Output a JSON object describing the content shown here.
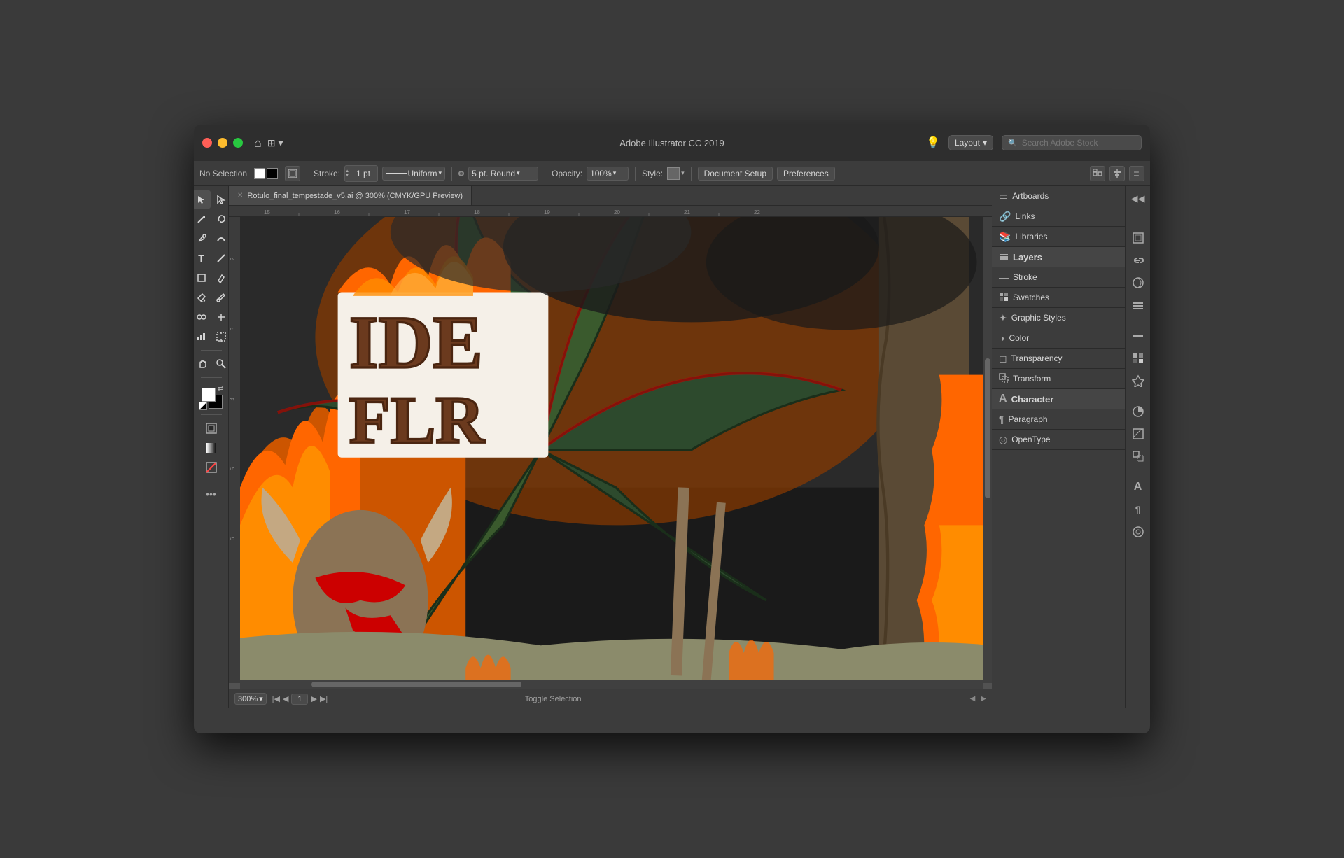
{
  "app": {
    "title": "Adobe Illustrator CC 2019",
    "window_title": "Adobe Illustrator CC 2019"
  },
  "titlebar": {
    "title": "Adobe Illustrator CC 2019",
    "layout_label": "Layout",
    "search_placeholder": "Search Adobe Stock",
    "home_icon": "⌂",
    "workspace_icon": "⊞",
    "lightbulb_icon": "💡"
  },
  "toolbar": {
    "no_selection": "No Selection",
    "stroke_label": "Stroke:",
    "stroke_value": "1 pt",
    "stroke_type": "Uniform",
    "pt_round": "5 pt. Round",
    "opacity_label": "Opacity:",
    "opacity_value": "100%",
    "style_label": "Style:",
    "document_setup": "Document Setup",
    "preferences": "Preferences"
  },
  "tab": {
    "filename": "Rotulo_final_tempestade_v5.ai @ 300% (CMYK/GPU Preview)"
  },
  "canvas": {
    "zoom": "300%",
    "page": "1",
    "toggle_selection": "Toggle Selection"
  },
  "right_panels": {
    "sections": [
      {
        "id": "artboards",
        "label": "Artboards",
        "icon": "▭"
      },
      {
        "id": "links",
        "label": "Links",
        "icon": "🔗"
      },
      {
        "id": "libraries",
        "label": "Libraries",
        "icon": "📚"
      },
      {
        "id": "layers",
        "label": "Layers",
        "icon": "▤"
      },
      {
        "id": "stroke",
        "label": "Stroke",
        "icon": "—"
      },
      {
        "id": "swatches",
        "label": "Swatches",
        "icon": "◼"
      },
      {
        "id": "graphic_styles",
        "label": "Graphic Styles",
        "icon": "✦"
      },
      {
        "id": "color",
        "label": "Color",
        "icon": "◑"
      },
      {
        "id": "transparency",
        "label": "Transparency",
        "icon": "◻"
      },
      {
        "id": "transform",
        "label": "Transform",
        "icon": "⊞"
      },
      {
        "id": "character",
        "label": "Character",
        "icon": "A"
      },
      {
        "id": "paragraph",
        "label": "Paragraph",
        "icon": "¶"
      },
      {
        "id": "opentype",
        "label": "OpenType",
        "icon": "◎"
      }
    ]
  },
  "tools": {
    "select": "▶",
    "direct_select": "↖",
    "pen": "✒",
    "curvature": "~",
    "type": "T",
    "line": "/",
    "rect": "□",
    "pencil": "✏",
    "paintbucket": "◈",
    "eyedropper": "🔍",
    "blend": "8",
    "symbol": "☊",
    "bar_graph": "▦",
    "artboard": "⊡",
    "hand": "✋",
    "zoom": "🔍"
  },
  "colors": {
    "titlebar_bg": "#2e2e2e",
    "toolbar_bg": "#3c3c3c",
    "canvas_bg": "#525252",
    "panel_bg": "#3c3c3c",
    "border": "#2a2a2a",
    "text_primary": "#d4d4d4",
    "text_secondary": "#a0a0a0",
    "accent": "#4a90d9",
    "close_btn": "#ff5f57",
    "minimize_btn": "#febc2e",
    "maximize_btn": "#28c840"
  }
}
